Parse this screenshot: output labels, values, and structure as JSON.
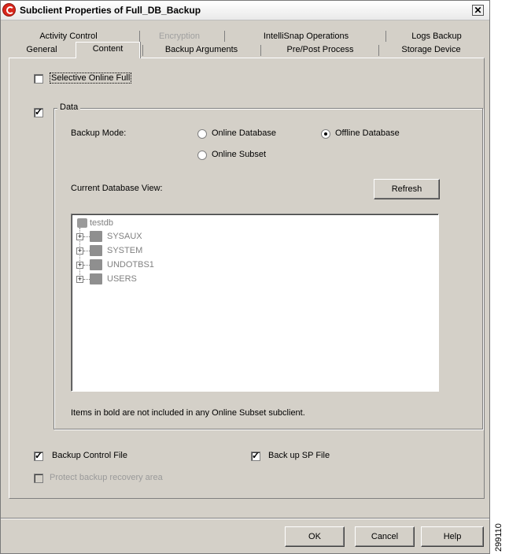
{
  "window": {
    "title": "Subclient Properties of Full_DB_Backup",
    "close_symbol": "✕"
  },
  "tabs": {
    "row1": [
      {
        "label": "Activity Control",
        "disabled": false
      },
      {
        "label": "Encryption",
        "disabled": true
      },
      {
        "label": "IntelliSnap Operations",
        "disabled": false
      },
      {
        "label": "Logs Backup",
        "disabled": false
      }
    ],
    "row2": [
      {
        "label": "General",
        "disabled": false
      },
      {
        "label": "Content",
        "disabled": false,
        "active": true
      },
      {
        "label": "Backup Arguments",
        "disabled": false
      },
      {
        "label": "Pre/Post Process",
        "disabled": false
      },
      {
        "label": "Storage Device",
        "disabled": false
      }
    ]
  },
  "content": {
    "selective_online_full": {
      "label": "Selective Online Full",
      "checked": false
    },
    "data": {
      "label": "Data",
      "checked": true,
      "backup_mode_label": "Backup Mode:",
      "options": [
        {
          "label": "Online Database",
          "selected": false
        },
        {
          "label": "Offline Database",
          "selected": true
        },
        {
          "label": "Online Subset",
          "selected": false
        }
      ],
      "current_db_view_label": "Current Database View:",
      "refresh_label": "Refresh",
      "tree": {
        "root": "testdb",
        "children": [
          "SYSAUX",
          "SYSTEM",
          "UNDOTBS1",
          "USERS"
        ]
      },
      "note": "Items in bold are not included in any Online Subset subclient."
    },
    "backup_control_file": {
      "label": "Backup Control File",
      "checked": true
    },
    "back_up_sp_file": {
      "label": "Back up SP File",
      "checked": true
    },
    "protect_recovery_area": {
      "label": "Protect backup recovery area",
      "checked": false,
      "disabled": true
    }
  },
  "buttons": {
    "ok": "OK",
    "cancel": "Cancel",
    "help": "Help"
  },
  "side_label": "299110"
}
